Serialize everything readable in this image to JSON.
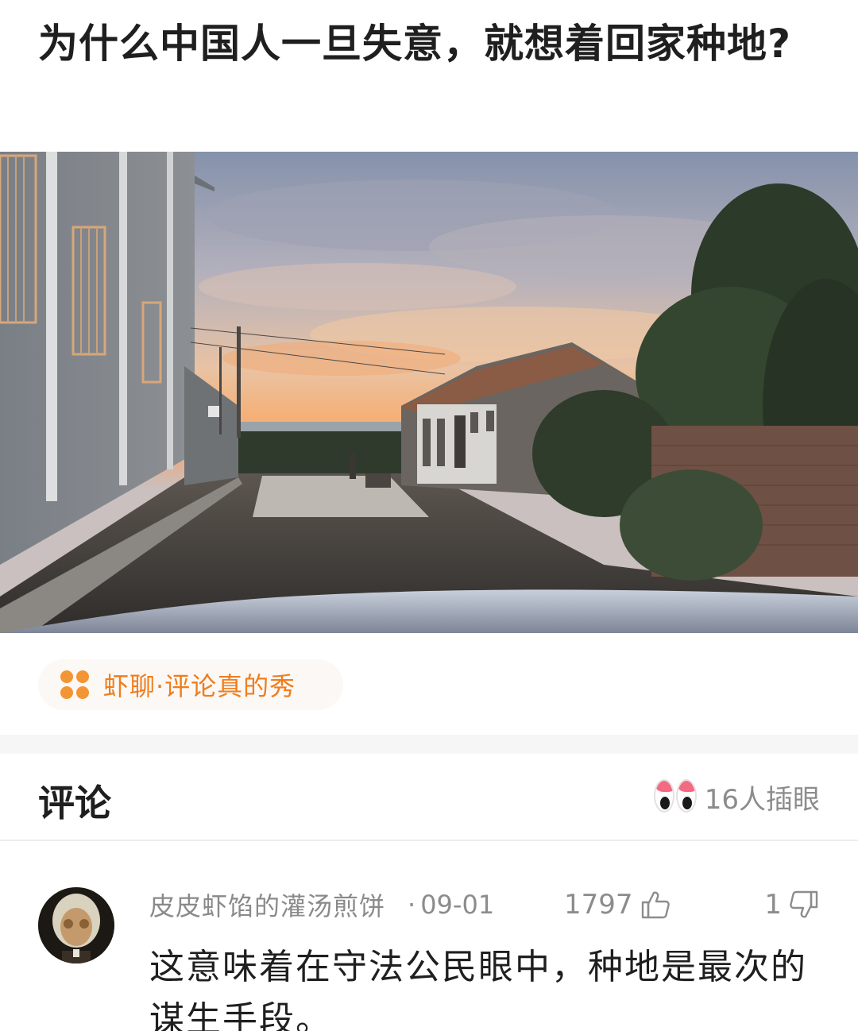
{
  "post": {
    "title": "为什么中国人一旦失意，就想着回家种地?"
  },
  "topic": {
    "label": "虾聊·评论真的秀",
    "icon": "four-dots-icon",
    "color": "#f07d1b"
  },
  "comments": {
    "header": "评论",
    "peek_count": "16人插眼",
    "peek_icon": "peeking-eyes-icon",
    "items": [
      {
        "username": "皮皮虾馅的灌汤煎饼",
        "separator": "·",
        "date": "09-01",
        "likes": "1797",
        "dislikes": "1",
        "text": "这意味着在守法公民眼中，种地是最次的谋生手段。"
      }
    ]
  }
}
